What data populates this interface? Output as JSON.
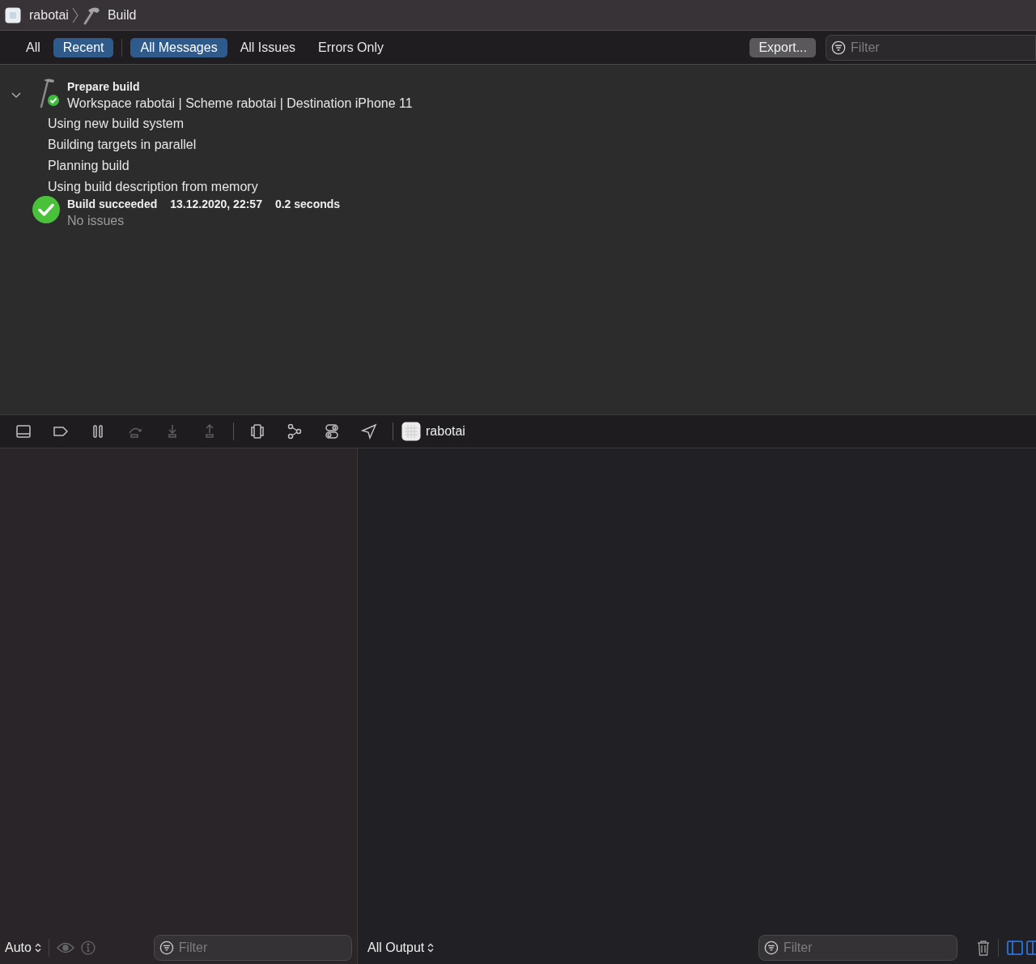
{
  "breadcrumb": [
    {
      "text": "rabotai",
      "kind": "app"
    },
    {
      "text": "Build",
      "kind": "build"
    }
  ],
  "scope_tabs": [
    {
      "label": "All",
      "selected": false
    },
    {
      "label": "Recent",
      "selected": true
    }
  ],
  "message_tabs": [
    {
      "label": "All Messages",
      "selected": true
    },
    {
      "label": "All Issues",
      "selected": false
    },
    {
      "label": "Errors Only",
      "selected": false
    }
  ],
  "export_button": "Export...",
  "filter": {
    "placeholder": "Filter"
  },
  "log": {
    "expanded": true,
    "title": "Prepare build",
    "subtitle": "Workspace rabotai | Scheme rabotai | Destination iPhone 11",
    "messages": [
      "Using new build system",
      "Building targets in parallel",
      "Planning build",
      "Using build description from memory"
    ],
    "result": {
      "title": "Build succeeded",
      "date": "13.12.2020, 22:57",
      "duration": "0.2 seconds",
      "detail": "No issues"
    }
  },
  "debug_toolbar": {
    "buttons": [
      {
        "kind": "console",
        "disabled": false
      },
      {
        "kind": "breakpoints",
        "disabled": false
      },
      {
        "kind": "pause",
        "disabled": false
      },
      {
        "kind": "step_over",
        "disabled": true
      },
      {
        "kind": "step_in",
        "disabled": true
      },
      {
        "kind": "step_out",
        "disabled": true
      },
      {
        "kind": "divider"
      },
      {
        "kind": "view_debugger",
        "disabled": false
      },
      {
        "kind": "memory_graph",
        "disabled": false
      },
      {
        "kind": "environment",
        "disabled": false
      },
      {
        "kind": "location",
        "disabled": false
      },
      {
        "kind": "divider"
      }
    ],
    "target": "rabotai"
  },
  "variables_pane": {
    "scope": "Auto",
    "filter": {
      "placeholder": "Filter"
    }
  },
  "console_pane": {
    "output": "All Output",
    "filter": {
      "placeholder": "Filter"
    }
  }
}
